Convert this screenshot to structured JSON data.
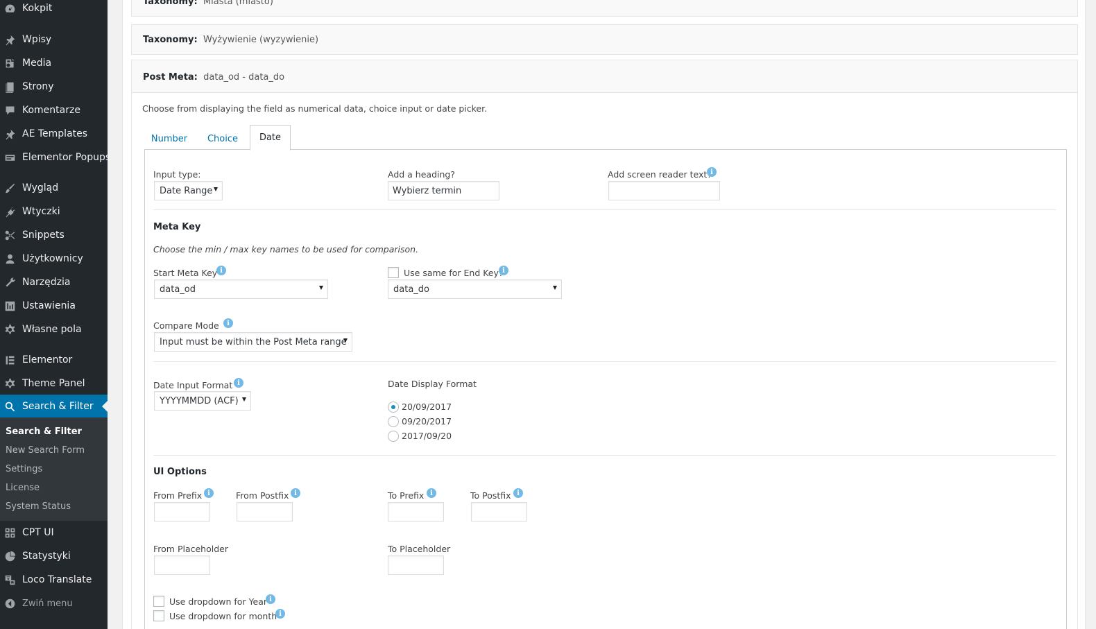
{
  "sidebar": {
    "items": [
      {
        "label": "Kokpit",
        "icon": "dashboard-icon"
      },
      {
        "label": "Wpisy",
        "icon": "pin-icon"
      },
      {
        "label": "Media",
        "icon": "media-icon"
      },
      {
        "label": "Strony",
        "icon": "page-icon"
      },
      {
        "label": "Komentarze",
        "icon": "comment-icon"
      },
      {
        "label": "AE Templates",
        "icon": "pin-icon"
      },
      {
        "label": "Elementor Popups",
        "icon": "popup-icon"
      },
      {
        "label": "Wygląd",
        "icon": "brush-icon"
      },
      {
        "label": "Wtyczki",
        "icon": "plugin-icon"
      },
      {
        "label": "Snippets",
        "icon": "scissors-icon"
      },
      {
        "label": "Użytkownicy",
        "icon": "user-icon"
      },
      {
        "label": "Narzędzia",
        "icon": "wrench-icon"
      },
      {
        "label": "Ustawienia",
        "icon": "settings-icon"
      },
      {
        "label": "Własne pola",
        "icon": "gear-icon"
      },
      {
        "label": "Elementor",
        "icon": "elementor-icon"
      },
      {
        "label": "Theme Panel",
        "icon": "gear-icon"
      },
      {
        "label": "Search & Filter",
        "icon": "search-icon"
      },
      {
        "label": "CPT UI",
        "icon": "grid-icon"
      },
      {
        "label": "Statystyki",
        "icon": "pie-chart-icon"
      },
      {
        "label": "Loco Translate",
        "icon": "translate-icon"
      },
      {
        "label": "Zwiń menu",
        "icon": "collapse-icon"
      }
    ],
    "submenu": [
      "Search & Filter",
      "New Search Form",
      "Settings",
      "License",
      "System Status"
    ]
  },
  "widgets": {
    "taxonomy1": {
      "prefix": "Taxonomy:",
      "value": "Miasta (miasto)"
    },
    "taxonomy2": {
      "prefix": "Taxonomy:",
      "value": "Wyżywienie (wyzywienie)"
    },
    "postmeta": {
      "prefix": "Post Meta:",
      "value": "data_od - data_do"
    }
  },
  "postmeta": {
    "description": "Choose from displaying the field as numerical data, choice input or date picker.",
    "tabs": [
      "Number",
      "Choice",
      "Date"
    ],
    "input_type_label": "Input type:",
    "input_type_value": "Date Range",
    "heading_label": "Add a heading?",
    "heading_value": "Wybierz termin",
    "screen_reader_label": "Add screen reader text?",
    "meta_key_heading": "Meta Key",
    "meta_key_desc": "Choose the min / max key names to be used for comparison.",
    "start_meta_label": "Start Meta Key",
    "start_meta_value": "data_od",
    "use_same_label": "Use same for End Key?",
    "end_meta_value": "data_do",
    "compare_mode_label": "Compare Mode",
    "compare_mode_value": "Input must be within the Post Meta range",
    "date_input_format_label": "Date Input Format",
    "date_input_format_value": "YYYYMMDD (ACF)",
    "date_display_format_label": "Date Display Format",
    "date_display_options": [
      "20/09/2017",
      "09/20/2017",
      "2017/09/20"
    ],
    "ui_options_heading": "UI Options",
    "from_prefix_label": "From Prefix",
    "from_postfix_label": "From Postfix",
    "to_prefix_label": "To Prefix",
    "to_postfix_label": "To Postfix",
    "from_placeholder_label": "From Placeholder",
    "to_placeholder_label": "To Placeholder",
    "dropdown_year_label": "Use dropdown for Year",
    "dropdown_month_label": "Use dropdown for month"
  },
  "colors": {
    "sidebar_bg": "#23282d",
    "active": "#0073aa",
    "info": "#72b9e6"
  }
}
